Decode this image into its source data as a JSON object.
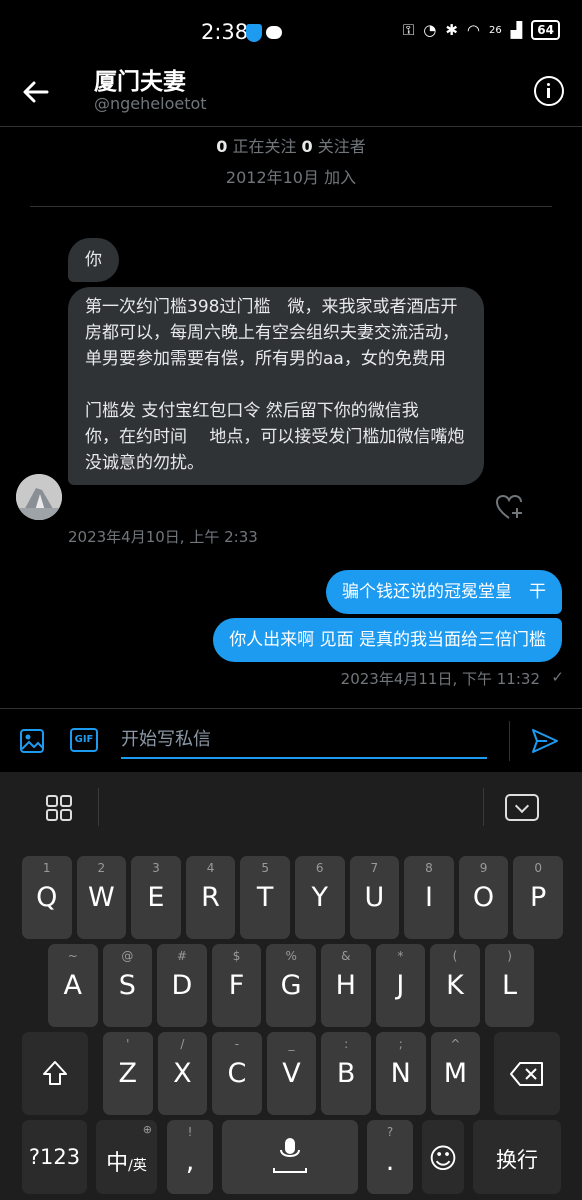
{
  "status_bar": {
    "time": "2:38",
    "network": "26",
    "battery": "64"
  },
  "header": {
    "title": "厦门夫妻",
    "handle": "@ngeheloetot"
  },
  "profile": {
    "following_count": "0",
    "following_label": "正在关注",
    "followers_count": "0",
    "followers_label": "关注者",
    "joined": "2012年10月 加入"
  },
  "messages": [
    {
      "direction": "in",
      "text": "你"
    },
    {
      "direction": "in",
      "text": "第一次约门槛398过门槛　微，来我家或者酒店开房都可以，每周六晚上有空会组织夫妻交流活动，单男要参加需要有偿，所有男的aa，女的免费用\n\n门槛发 支付宝红包口令 然后留下你的微信我　你，在约时间　 地点，可以接受发门槛加微信嘴炮没诚意的勿扰。"
    },
    {
      "direction": "out",
      "text": "骗个钱还说的冠冕堂皇　干"
    },
    {
      "direction": "out",
      "text": "你人出来啊  见面  是真的我当面给三倍门槛"
    }
  ],
  "timestamps": {
    "incoming": "2023年4月10日, 上午 2:33",
    "outgoing": "2023年4月11日, 下午 11:32"
  },
  "composer": {
    "placeholder": "开始写私信",
    "gif_label": "GIF"
  },
  "keyboard": {
    "row1": [
      {
        "hint": "1",
        "key": "Q"
      },
      {
        "hint": "2",
        "key": "W"
      },
      {
        "hint": "3",
        "key": "E"
      },
      {
        "hint": "4",
        "key": "R"
      },
      {
        "hint": "5",
        "key": "T"
      },
      {
        "hint": "6",
        "key": "Y"
      },
      {
        "hint": "7",
        "key": "U"
      },
      {
        "hint": "8",
        "key": "I"
      },
      {
        "hint": "9",
        "key": "O"
      },
      {
        "hint": "0",
        "key": "P"
      }
    ],
    "row2": [
      {
        "hint": "~",
        "key": "A"
      },
      {
        "hint": "@",
        "key": "S"
      },
      {
        "hint": "#",
        "key": "D"
      },
      {
        "hint": "$",
        "key": "F"
      },
      {
        "hint": "%",
        "key": "G"
      },
      {
        "hint": "&",
        "key": "H"
      },
      {
        "hint": "*",
        "key": "J"
      },
      {
        "hint": "(",
        "key": "K"
      },
      {
        "hint": ")",
        "key": "L"
      }
    ],
    "row3": [
      {
        "hint": "'",
        "key": "Z"
      },
      {
        "hint": "/",
        "key": "X"
      },
      {
        "hint": "-",
        "key": "C"
      },
      {
        "hint": "_",
        "key": "V"
      },
      {
        "hint": ":",
        "key": "B"
      },
      {
        "hint": ";",
        "key": "N"
      },
      {
        "hint": "^",
        "key": "M"
      }
    ],
    "num_label": "?123",
    "lang_label": "中",
    "lang_sub": "/英",
    "comma": ",",
    "comma_hint": "!",
    "period": ".",
    "period_hint": "?",
    "enter_label": "换行"
  }
}
